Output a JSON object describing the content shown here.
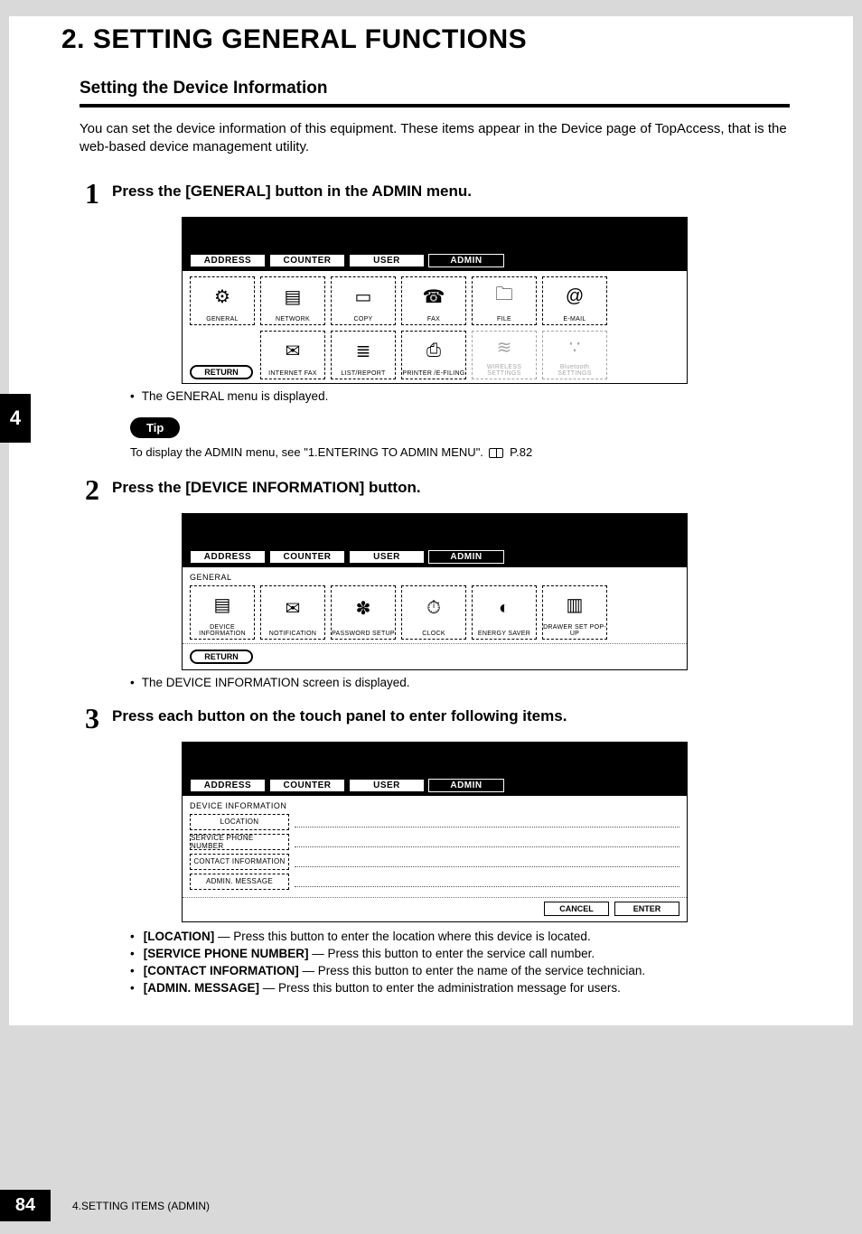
{
  "chapter_title": "2. SETTING GENERAL FUNCTIONS",
  "section_heading": "Setting the Device Information",
  "intro_text": "You can set the device information of this equipment.  These items appear in the Device page of TopAccess, that is the web-based device management utility.",
  "side_tab": "4",
  "tip_label": "Tip",
  "tip_text_prefix": "To display the ADMIN menu, see \"1.ENTERING TO ADMIN MENU\".",
  "tip_page_ref": "P.82",
  "tabs": {
    "address": "ADDRESS",
    "counter": "COUNTER",
    "user": "USER",
    "admin": "ADMIN"
  },
  "return_label": "RETURN",
  "steps": [
    {
      "num": "1",
      "text": "Press the [GENERAL] button in the ADMIN menu.",
      "note": "The GENERAL menu is displayed.",
      "screen": {
        "row1": [
          {
            "label": "GENERAL",
            "glyph": "⚙"
          },
          {
            "label": "NETWORK",
            "glyph": "▤"
          },
          {
            "label": "COPY",
            "glyph": "▭"
          },
          {
            "label": "FAX",
            "glyph": "☎"
          },
          {
            "label": "FILE",
            "glyph": "🗀"
          },
          {
            "label": "E-MAIL",
            "glyph": "@"
          }
        ],
        "row2": [
          {
            "label": "INTERNET FAX",
            "glyph": "✉"
          },
          {
            "label": "LIST/REPORT",
            "glyph": "≣"
          },
          {
            "label": "PRINTER /E-FILING",
            "glyph": "⎙"
          },
          {
            "label": "WIRELESS SETTINGS",
            "glyph": "≋",
            "faded": true
          },
          {
            "label": "Bluetooth SETTINGS",
            "glyph": "∵",
            "faded": true
          }
        ]
      }
    },
    {
      "num": "2",
      "text": "Press the [DEVICE INFORMATION] button.",
      "note": "The DEVICE INFORMATION screen is displayed.",
      "screen": {
        "sub": "GENERAL",
        "row1": [
          {
            "label": "DEVICE INFORMATION",
            "glyph": "▤"
          },
          {
            "label": "NOTIFICATION",
            "glyph": "✉"
          },
          {
            "label": "PASSWORD SETUP",
            "glyph": "✽"
          },
          {
            "label": "CLOCK",
            "glyph": "⏱"
          },
          {
            "label": "ENERGY SAVER",
            "glyph": "◐"
          },
          {
            "label": "DRAWER SET POP-UP",
            "glyph": "▥"
          }
        ]
      }
    },
    {
      "num": "3",
      "text": "Press each button on the touch panel to enter following items.",
      "screen": {
        "sub": "DEVICE INFORMATION",
        "fields": [
          "LOCATION",
          "SERVICE PHONE NUMBER",
          "CONTACT INFORMATION",
          "ADMIN. MESSAGE"
        ],
        "cancel": "CANCEL",
        "enter": "ENTER"
      },
      "descriptions": [
        {
          "b": "[LOCATION]",
          "t": " — Press this button to enter the location where this device is located."
        },
        {
          "b": "[SERVICE PHONE NUMBER]",
          "t": " — Press this button to enter the service call number."
        },
        {
          "b": "[CONTACT INFORMATION]",
          "t": " — Press this button to enter the name of the service technician."
        },
        {
          "b": "[ADMIN. MESSAGE]",
          "t": " — Press this button to enter the administration message for users."
        }
      ]
    }
  ],
  "footer": {
    "page": "84",
    "text": "4.SETTING ITEMS (ADMIN)"
  }
}
